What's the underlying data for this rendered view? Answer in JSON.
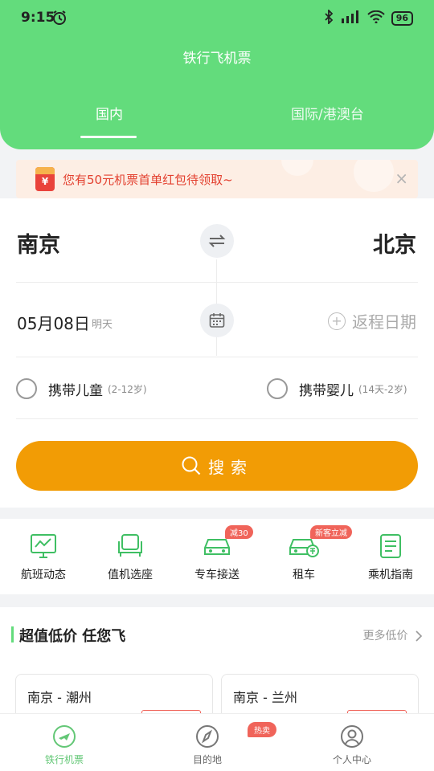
{
  "status": {
    "time": "9:15",
    "battery": "96"
  },
  "header": {
    "title": "铁行飞机票",
    "tabs": [
      {
        "label": "国内"
      },
      {
        "label": "国际/港澳台"
      }
    ]
  },
  "banner": {
    "icon_text": "¥",
    "text": "您有50元机票首单红包待领取~",
    "close": "×"
  },
  "search_card": {
    "from_city": "南京",
    "to_city": "北京",
    "date": "05月08日",
    "date_sub": "明天",
    "return_label": "返程日期",
    "child": {
      "label": "携带儿童",
      "hint": "(2-12岁)"
    },
    "infant": {
      "label": "携带婴儿",
      "hint": "(14天-2岁)"
    },
    "search_button": "搜索"
  },
  "services": [
    {
      "label": "航班动态",
      "icon": "flight-status-icon"
    },
    {
      "label": "值机选座",
      "icon": "checkin-seat-icon"
    },
    {
      "label": "专车接送",
      "icon": "car-transfer-icon",
      "badge": "减30"
    },
    {
      "label": "租车",
      "icon": "car-rental-icon",
      "badge": "新客立减"
    },
    {
      "label": "乘机指南",
      "icon": "guide-icon"
    }
  ],
  "deals": {
    "title": "超值低价 任您飞",
    "more": "更多低价",
    "routes": [
      {
        "route": "南京 - 潮州"
      },
      {
        "route": "南京 - 兰州"
      }
    ]
  },
  "tabbar": {
    "items": [
      {
        "label": "铁行机票"
      },
      {
        "label": "目的地"
      },
      {
        "label": "个人中心"
      }
    ],
    "hot_badge": "热卖"
  },
  "colors": {
    "brand_green": "#63dc7c",
    "search_orange": "#f29c05",
    "badge_red": "#f0645a"
  }
}
